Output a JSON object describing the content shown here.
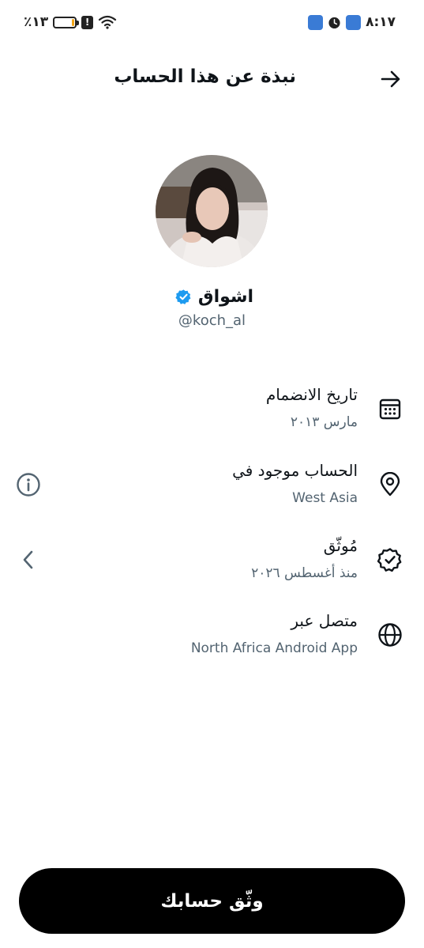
{
  "status_bar": {
    "time": "٨:١٧",
    "battery_text": "٪١٣",
    "battery_level": 0.13,
    "icons": [
      "app-icon",
      "clock-icon",
      "app-icon",
      "alert-icon",
      "wifi-icon",
      "battery-icon"
    ]
  },
  "header": {
    "title": "نبذة عن هذا الحساب",
    "back_icon": "arrow-right-icon"
  },
  "profile": {
    "display_name": "اشواق",
    "handle": "@koch_al",
    "verified": true,
    "verified_color": "#1d9bf0"
  },
  "info_rows": [
    {
      "icon": "calendar-icon",
      "title": "تاريخ الانضمام",
      "subtitle": "مارس ٢٠١٣"
    },
    {
      "icon": "location-pin-icon",
      "title": "الحساب موجود في",
      "subtitle": "West Asia",
      "action_icon": "info-circle-icon"
    },
    {
      "icon": "verified-badge-icon",
      "title": "مُوثّق",
      "subtitle": "منذ أغسطس ٢٠٢٦",
      "action_icon": "chevron-left-icon"
    },
    {
      "icon": "globe-icon",
      "title": "متصل عبر",
      "subtitle": "North Africa Android App"
    }
  ],
  "footer": {
    "verify_button_label": "وثّق حسابك"
  },
  "colors": {
    "text_primary": "#0f1419",
    "text_secondary": "#536471",
    "button_bg": "#000000",
    "battery_fill": "#f2a516"
  }
}
